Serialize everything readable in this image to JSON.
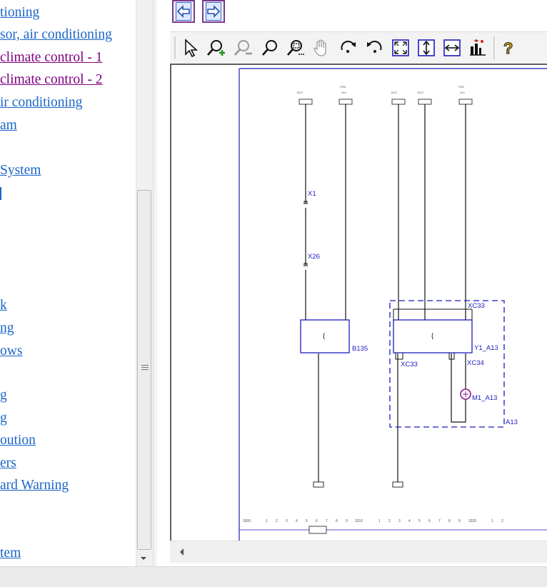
{
  "nav": {
    "items": [
      {
        "label": "tioning",
        "color": "blue"
      },
      {
        "label": "sor, air conditioning",
        "color": "blue"
      },
      {
        "label": "climate control - 1",
        "color": "purple"
      },
      {
        "label": "climate control - 2",
        "color": "purple"
      },
      {
        "label": "ir conditioning",
        "color": "blue"
      },
      {
        "label": "am",
        "color": "blue"
      },
      {
        "label": "System",
        "color": "blue"
      },
      {
        "label": "k",
        "color": "blue"
      },
      {
        "label": "ng",
        "color": "blue"
      },
      {
        "label": "ows",
        "color": "blue"
      },
      {
        "label": "g",
        "color": "blue"
      },
      {
        "label": "g",
        "color": "blue"
      },
      {
        "label": "oution",
        "color": "blue"
      },
      {
        "label": "ers",
        "color": "blue"
      },
      {
        "label": "ard Warning",
        "color": "blue"
      },
      {
        "label": "tem",
        "color": "blue"
      }
    ]
  },
  "toolbar": {
    "tools": [
      "select-pointer",
      "zoom-in",
      "zoom-out",
      "zoom",
      "zoom-window",
      "pan-hand",
      "rotate-right",
      "rotate-left",
      "fit-page",
      "fit-height",
      "fit-width",
      "properties",
      "help"
    ]
  },
  "schematic": {
    "labels": {
      "x1": "X1",
      "x26": "X26",
      "xc33_top": "XC33",
      "b135": "B135",
      "xc33_bottom": "XC33",
      "xc34": "XC34",
      "y1_a13": "Y1_A13",
      "m1_a13": "M1_A13",
      "a13": "A13"
    },
    "ruler": {
      "seg1": "3300",
      "seg2": "3310",
      "seg3": "3320",
      "digits": [
        "1",
        "2",
        "3",
        "4",
        "5",
        "6",
        "7",
        "8",
        "9"
      ]
    }
  },
  "colors": {
    "link_blue": "#1a66c8",
    "link_visited": "#800080",
    "schematic_blue": "#1b1bc0",
    "wire": "#222222",
    "motor": "#8a1a8a"
  }
}
